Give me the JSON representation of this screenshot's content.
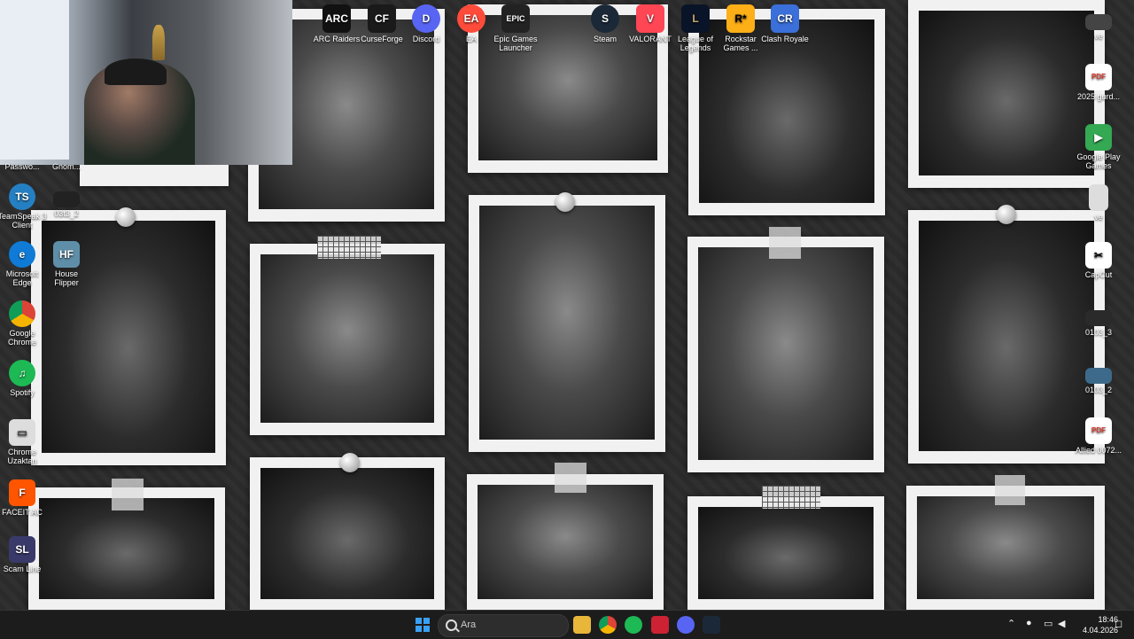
{
  "webcam": {
    "label": "webcam-overlay"
  },
  "top_icons": [
    {
      "label": "ARC Raiders",
      "glyph": "ARC",
      "color": "#111111"
    },
    {
      "label": "CurseForge",
      "glyph": "CF",
      "color": "#1a1a1a"
    },
    {
      "label": "Discord",
      "glyph": "D",
      "color": "#5865f2"
    },
    {
      "label": "EA",
      "glyph": "EA",
      "color": "#ff4b3a"
    },
    {
      "label": "Epic Games Launcher",
      "glyph": "EPIC",
      "color": "#222222"
    },
    {
      "label": "Steam",
      "glyph": "S",
      "color": "#1b2838"
    },
    {
      "label": "VALORANT",
      "glyph": "V",
      "color": "#ff4655"
    },
    {
      "label": "League of Legends",
      "glyph": "L",
      "color": "#0a1428"
    },
    {
      "label": "Rockstar Games ...",
      "glyph": "R*",
      "color": "#fcaf17"
    },
    {
      "label": "Clash Royale",
      "glyph": "CR",
      "color": "#3b6fd9"
    }
  ],
  "left_icons": [
    {
      "label": "Passwo...",
      "glyph": "",
      "color": "#333333"
    },
    {
      "label": "Gnom...",
      "glyph": "",
      "color": "#333333"
    },
    {
      "label": "TeamSpeak 3 Client",
      "glyph": "TS",
      "color": "#2580c3"
    },
    {
      "label": "03t3_2",
      "glyph": "",
      "color": "#222222"
    },
    {
      "label": "Microsoft Edge",
      "glyph": "e",
      "color": "#0f7bd6"
    },
    {
      "label": "House Flipper",
      "glyph": "HF",
      "color": "#5f8fa8"
    },
    {
      "label": "Google Chrome",
      "glyph": "●",
      "color": "#db4437"
    },
    {
      "label": "Spotify",
      "glyph": "♫",
      "color": "#1db954"
    },
    {
      "label": "Chrome Uzaktan",
      "glyph": "▭",
      "color": "#dddddd"
    },
    {
      "label": "FACEIT AC",
      "glyph": "F",
      "color": "#ff5500"
    },
    {
      "label": "Scam Line",
      "glyph": "SL",
      "color": "#3a3a6a"
    }
  ],
  "right_icons": [
    {
      "label": "ve",
      "glyph": "",
      "color": "#444444"
    },
    {
      "label": "2025 gurd...",
      "glyph": "PDF",
      "color": "#e33b2e"
    },
    {
      "label": "Google Play Games",
      "glyph": "▶",
      "color": "#34a853"
    },
    {
      "label": "ve",
      "glyph": "",
      "color": "#dddddd"
    },
    {
      "label": "CapCut",
      "glyph": "✂",
      "color": "#111111"
    },
    {
      "label": "0103_3",
      "glyph": "",
      "color": "#2a2a2a"
    },
    {
      "label": "0103_2",
      "glyph": "",
      "color": "#3d6a8a"
    },
    {
      "label": "Allied 0072...",
      "glyph": "PDF",
      "color": "#e33b2e"
    }
  ],
  "taskbar": {
    "search_placeholder": "Ara",
    "apps": [
      {
        "name": "file-explorer",
        "color": "#e8b73a"
      },
      {
        "name": "chrome",
        "color": "#db4437"
      },
      {
        "name": "spotify",
        "color": "#1db954"
      },
      {
        "name": "news",
        "color": "#cc2233"
      },
      {
        "name": "discord",
        "color": "#5865f2"
      },
      {
        "name": "steam",
        "color": "#1b2838"
      }
    ],
    "time": "18:46",
    "date": "4.04.2026"
  },
  "colors": {
    "accent": "#3aa0f3",
    "taskbar": "#1c1c1c"
  }
}
